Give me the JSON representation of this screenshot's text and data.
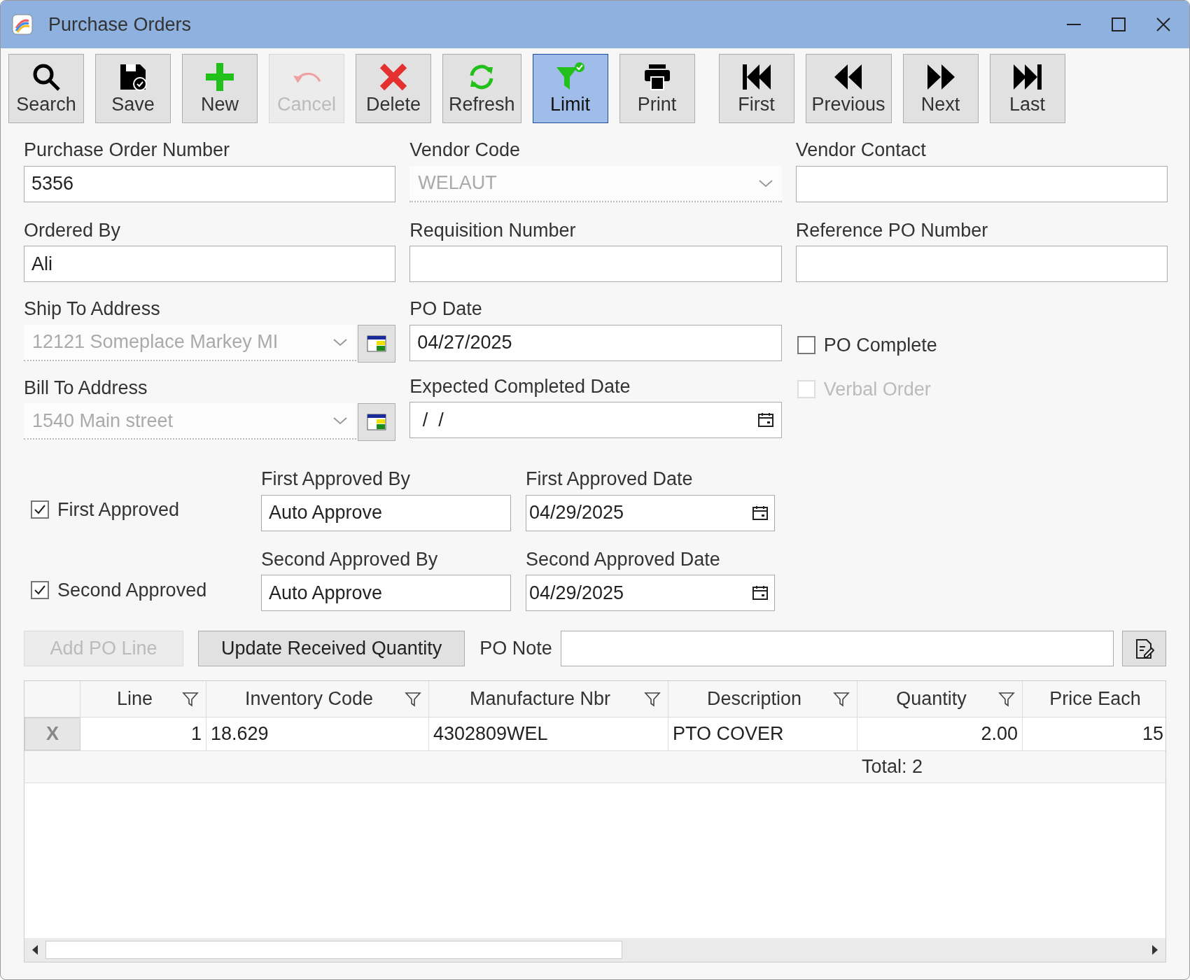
{
  "window": {
    "title": "Purchase Orders"
  },
  "toolbar": [
    {
      "kind": "search",
      "label": "Search",
      "disabled": false,
      "selected": false
    },
    {
      "kind": "save",
      "label": "Save",
      "disabled": false,
      "selected": false
    },
    {
      "kind": "new",
      "label": "New",
      "disabled": false,
      "selected": false
    },
    {
      "kind": "cancel",
      "label": "Cancel",
      "disabled": true,
      "selected": false
    },
    {
      "kind": "delete",
      "label": "Delete",
      "disabled": false,
      "selected": false
    },
    {
      "kind": "refresh",
      "label": "Refresh",
      "disabled": false,
      "selected": false
    },
    {
      "kind": "limit",
      "label": "Limit",
      "disabled": false,
      "selected": true
    },
    {
      "kind": "print",
      "label": "Print",
      "disabled": false,
      "selected": false
    },
    {
      "kind": "first",
      "label": "First",
      "disabled": false,
      "selected": false
    },
    {
      "kind": "previous",
      "label": "Previous",
      "disabled": false,
      "selected": false
    },
    {
      "kind": "next",
      "label": "Next",
      "disabled": false,
      "selected": false
    },
    {
      "kind": "last",
      "label": "Last",
      "disabled": false,
      "selected": false
    }
  ],
  "top_fields": [
    {
      "label": "Purchase Order Number",
      "kind": "text",
      "value": "5356",
      "disabled": false
    },
    {
      "label": "Vendor Code",
      "kind": "combo",
      "value": "WELAUT",
      "disabled": true
    },
    {
      "label": "Vendor Contact",
      "kind": "text",
      "disabled": false
    },
    {
      "label": "Ordered By",
      "kind": "text",
      "value": "Ali",
      "disabled": false
    },
    {
      "label": "Requisition Number",
      "kind": "text",
      "disabled": false
    },
    {
      "label": "Reference PO Number",
      "kind": "text",
      "disabled": false
    }
  ],
  "address_fields": [
    {
      "label": "Ship To Address",
      "kind": "combo",
      "value": "12121 Someplace Markey MI",
      "disabled": true
    },
    {
      "label": "Bill To Address",
      "kind": "combo",
      "value": "1540 Main street",
      "disabled": true
    }
  ],
  "date_fields": [
    {
      "label": "PO Date",
      "kind": "text",
      "value": "04/27/2025",
      "disabled": false
    },
    {
      "label": "Expected Completed Date",
      "kind": "date",
      "value": " /  /",
      "disabled": false
    }
  ],
  "checkboxes": [
    {
      "label": "PO Complete",
      "checked": false,
      "disabled": false
    },
    {
      "label": "Verbal Order",
      "checked": false,
      "disabled": true
    }
  ],
  "approvals": [
    {
      "label": "First Approved",
      "checked": true,
      "by_label": "First Approved By",
      "by_value": "Auto Approve",
      "date_label": "First Approved Date",
      "date_value": "04/29/2025"
    },
    {
      "label": "Second Approved",
      "checked": true,
      "by_label": "Second Approved By",
      "by_value": "Auto Approve",
      "date_label": "Second Approved Date",
      "date_value": "04/29/2025"
    }
  ],
  "actions": [
    {
      "label": "Add PO Line",
      "disabled": true
    },
    {
      "label": "Update Received Quantity",
      "disabled": false
    }
  ],
  "po_note": {
    "label": "PO Note"
  },
  "grid": {
    "columns": [
      {
        "label": "Line",
        "filter": true
      },
      {
        "label": "Inventory Code",
        "filter": true
      },
      {
        "label": "Manufacture Nbr",
        "filter": true
      },
      {
        "label": "Description",
        "filter": true
      },
      {
        "label": "Quantity",
        "filter": true
      },
      {
        "label": "Price Each",
        "filter": false
      }
    ],
    "rows": [
      {
        "marker": "X",
        "cells": [
          "1",
          "18.629",
          "4302809WEL",
          "PTO COVER",
          "2.00",
          "15"
        ]
      }
    ],
    "total": "Total: 2"
  }
}
